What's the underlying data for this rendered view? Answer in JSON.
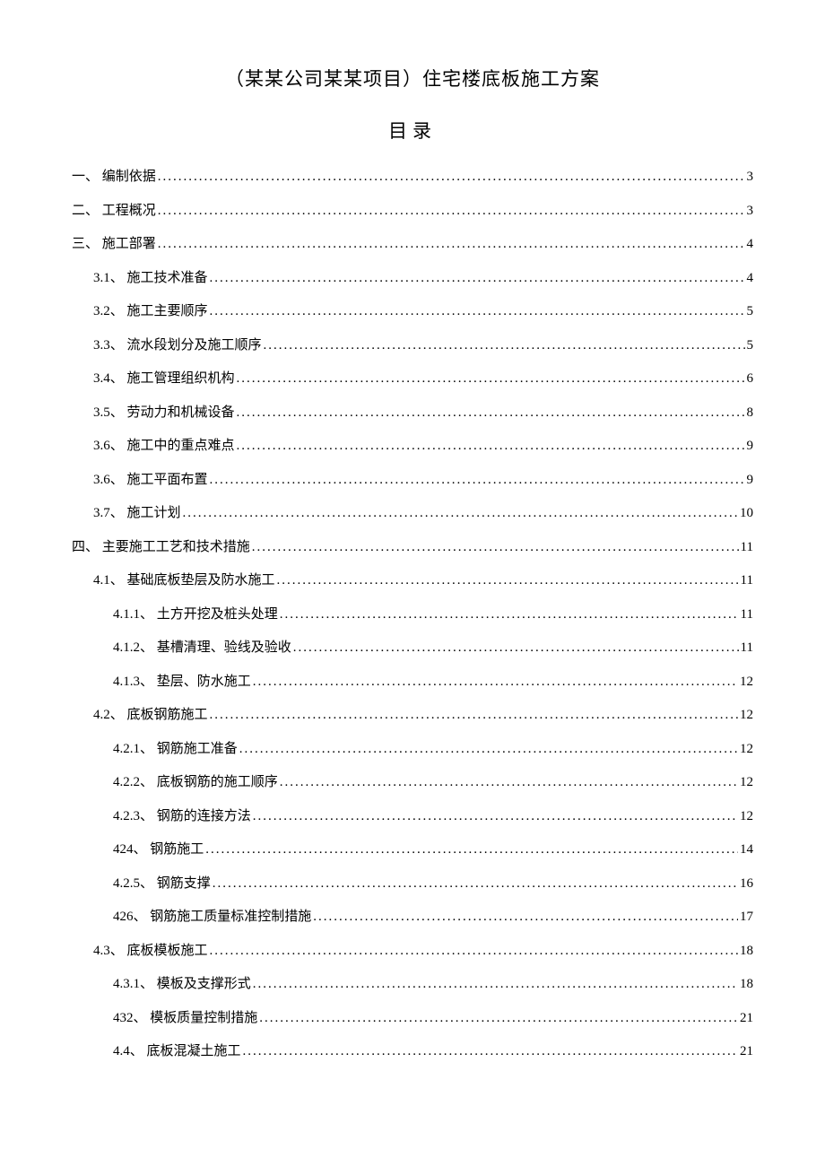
{
  "title": "（某某公司某某项目）住宅楼底板施工方案",
  "toc_heading": "目录",
  "toc": [
    {
      "level": 1,
      "num": "一、",
      "text": "编制依据",
      "page": "3"
    },
    {
      "level": 1,
      "num": "二、",
      "text": "工程概况",
      "page": "3"
    },
    {
      "level": 1,
      "num": "三、",
      "text": "施工部署",
      "page": "4"
    },
    {
      "level": 2,
      "num": "3.1、",
      "text": "施工技术准备",
      "page": "4"
    },
    {
      "level": 2,
      "num": "3.2、",
      "text": "施工主要顺序",
      "page": "5"
    },
    {
      "level": 2,
      "num": "3.3、",
      "text": "流水段划分及施工顺序",
      "page": "5"
    },
    {
      "level": 2,
      "num": "3.4、",
      "text": "施工管理组织机构",
      "page": "6"
    },
    {
      "level": 2,
      "num": "3.5、",
      "text": "劳动力和机械设备",
      "page": "8"
    },
    {
      "level": 2,
      "num": "3.6、",
      "text": "施工中的重点难点",
      "page": "9"
    },
    {
      "level": 2,
      "num": "3.6、",
      "text": "施工平面布置",
      "page": "9"
    },
    {
      "level": 2,
      "num": "3.7、",
      "text": "施工计划",
      "page": "10"
    },
    {
      "level": 1,
      "num": "四、",
      "text": "主要施工工艺和技术措施",
      "page": "11"
    },
    {
      "level": 2,
      "num": "4.1、",
      "text": "基础底板垫层及防水施工",
      "page": "11"
    },
    {
      "level": 3,
      "num": "4.1.1、",
      "text": "土方开挖及桩头处理",
      "page": "11"
    },
    {
      "level": 3,
      "num": "4.1.2、",
      "text": "基槽清理、验线及验收",
      "page": "11"
    },
    {
      "level": 3,
      "num": "4.1.3、",
      "text": "垫层、防水施工",
      "page": "12"
    },
    {
      "level": 2,
      "num": "4.2、",
      "text": "底板钢筋施工",
      "page": "12"
    },
    {
      "level": 3,
      "num": "4.2.1、",
      "text": "钢筋施工准备",
      "page": "12"
    },
    {
      "level": 3,
      "num": "4.2.2、",
      "text": "底板钢筋的施工顺序",
      "page": "12"
    },
    {
      "level": 3,
      "num": "4.2.3、",
      "text": "钢筋的连接方法",
      "page": "12"
    },
    {
      "level": 3,
      "num": "424、",
      "text": "钢筋施工",
      "page": "14"
    },
    {
      "level": 3,
      "num": "4.2.5、",
      "text": "钢筋支撑",
      "page": "16"
    },
    {
      "level": 3,
      "num": "426、",
      "text": "钢筋施工质量标准控制措施",
      "page": "17"
    },
    {
      "level": 2,
      "num": "4.3、",
      "text": "底板模板施工",
      "page": "18"
    },
    {
      "level": 3,
      "num": "4.3.1、",
      "text": "模板及支撑形式",
      "page": "18"
    },
    {
      "level": 3,
      "num": "432、",
      "text": "模板质量控制措施",
      "page": "21"
    },
    {
      "level": 3,
      "num": "4.4、",
      "text": "底板混凝土施工",
      "page": "21"
    }
  ]
}
